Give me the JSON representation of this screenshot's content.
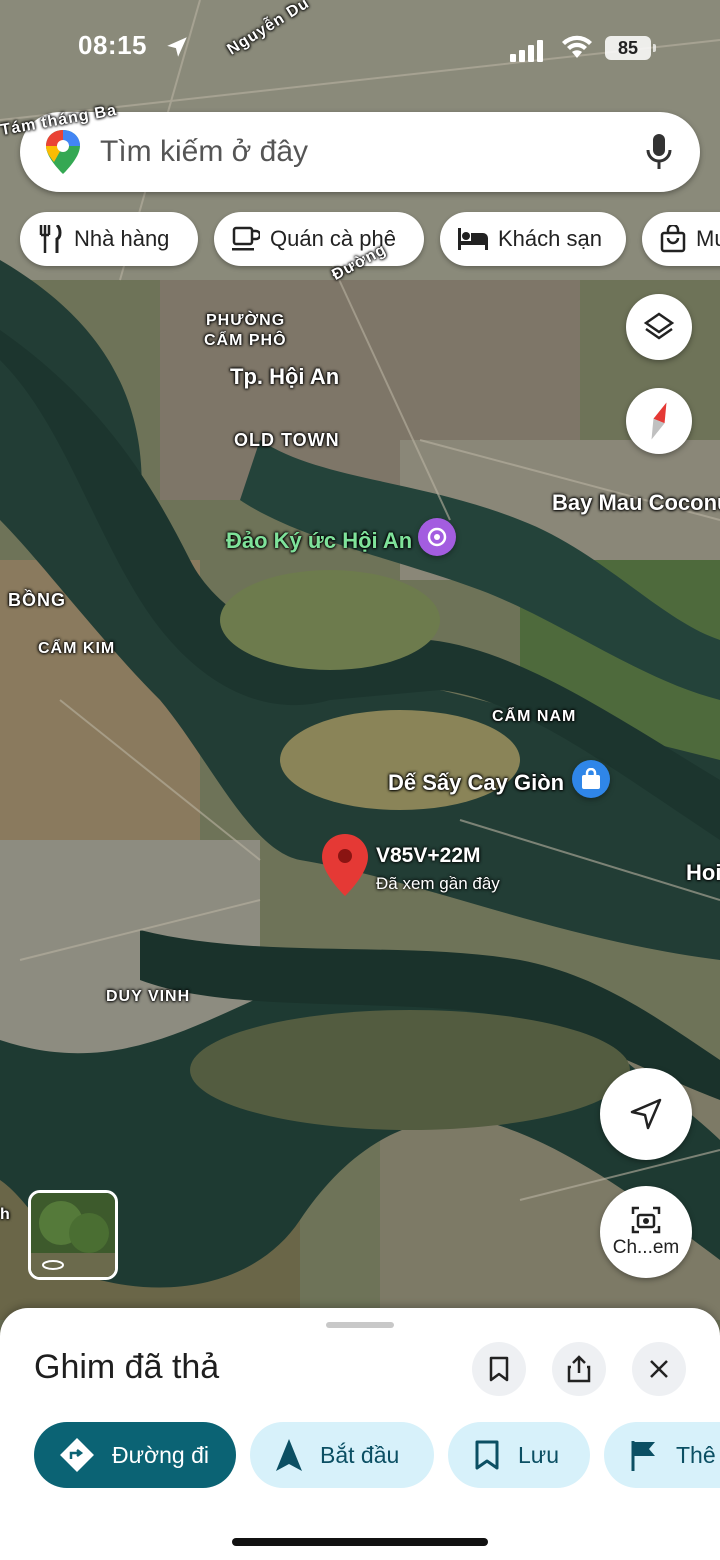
{
  "status_bar": {
    "time": "08:15",
    "battery": "85"
  },
  "search": {
    "placeholder": "Tìm kiếm ở đây"
  },
  "chips": [
    {
      "label": "Nhà hàng",
      "icon": "cutlery-icon"
    },
    {
      "label": "Quán cà phê",
      "icon": "coffee-icon"
    },
    {
      "label": "Khách sạn",
      "icon": "bed-icon"
    },
    {
      "label": "Mu",
      "icon": "shopping-bag-icon"
    }
  ],
  "map": {
    "labels": {
      "street_top": "Nguyễn Du",
      "street_left": "Tám tháng Ba",
      "street_mid": "Đường",
      "phuong": "PHƯỜNG",
      "cam_pho": "CẨM PHÔ",
      "hoi_an": "Tp. Hội An",
      "old_town": "OLD TOWN",
      "bay_mau": "Bay Mau Coconu",
      "dao_ky_uc": "Đảo Ký ức Hội An",
      "bong": "BỒNG",
      "cam_kim": "CẨM KIM",
      "cam_nam": "CẨM NAM",
      "de_say": "Dế Sấy Cay Giòn",
      "hoi": "Hoi",
      "duy_vinh": "DUY VINH",
      "h_edge": "h"
    },
    "pin": {
      "code": "V85V+22M",
      "subtitle": "Đã xem gần đây"
    },
    "camera_label": "Ch...em"
  },
  "sheet": {
    "title": "Ghim đã thả",
    "actions": [
      {
        "label": "Đường đi",
        "icon": "directions-icon"
      },
      {
        "label": "Bắt đầu",
        "icon": "navigation-arrow-icon"
      },
      {
        "label": "Lưu",
        "icon": "bookmark-icon"
      },
      {
        "label": "Thê",
        "icon": "flag-icon"
      }
    ]
  },
  "colors": {
    "primary_button": "#0b6374",
    "secondary_button": "#d7f1fa",
    "pin_red": "#e53935",
    "water": "#1f3a33",
    "land": "#5a6b4a"
  }
}
